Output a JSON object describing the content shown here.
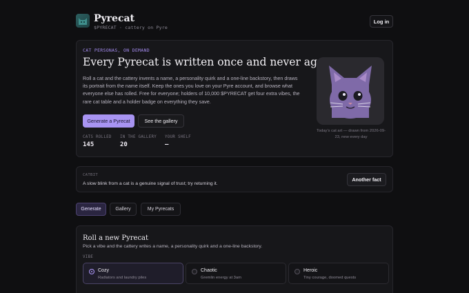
{
  "header": {
    "brand": "Pyrecat",
    "tagline": "$PYRECAT · cattery on Pyre",
    "login_label": "Log in"
  },
  "hero": {
    "eyebrow": "CAT PERSONAS, ON DEMAND",
    "title": "Every Pyrecat is written once and never again.",
    "description": "Roll a cat and the cattery invents a name, a personality quirk and a one-line backstory, then draws its portrait from the name itself. Keep the ones you love on your Pyre account, and browse what everyone else has rolled. Free for everyone; holders of 10,000 $PYRECAT get four extra vibes, the rare cat table and a holder badge on everything they save.",
    "primary_button": "Generate a Pyrecat",
    "secondary_button": "See the gallery",
    "stats": [
      {
        "label": "CATS ROLLED",
        "value": "145"
      },
      {
        "label": "IN THE GALLERY",
        "value": "20"
      },
      {
        "label": "YOUR SHELF",
        "value": "—"
      }
    ],
    "art_caption": "Today's cat art — drawn from 2026-09-23, new every day"
  },
  "fact": {
    "label": "CATBIT",
    "text": "A slow blink from a cat is a genuine signal of trust; try returning it.",
    "button": "Another fact"
  },
  "tabs": [
    {
      "label": "Generate",
      "active": true
    },
    {
      "label": "Gallery",
      "active": false
    },
    {
      "label": "My Pyrecats",
      "active": false
    }
  ],
  "roll": {
    "title": "Roll a new Pyrecat",
    "description": "Pick a vibe and the cattery writes a name, a personality quirk and a one-line backstory.",
    "vibe_label": "VIBE",
    "vibes": [
      {
        "name": "Cozy",
        "sub": "Radiators and laundry piles",
        "selected": true
      },
      {
        "name": "Chaotic",
        "sub": "Gremlin energy at 3am",
        "selected": false
      },
      {
        "name": "Heroic",
        "sub": "Tiny courage, doomed quests",
        "selected": false
      }
    ]
  },
  "colors": {
    "accent": "#a894f2",
    "background": "#0f0f11",
    "card": "#17171a"
  }
}
